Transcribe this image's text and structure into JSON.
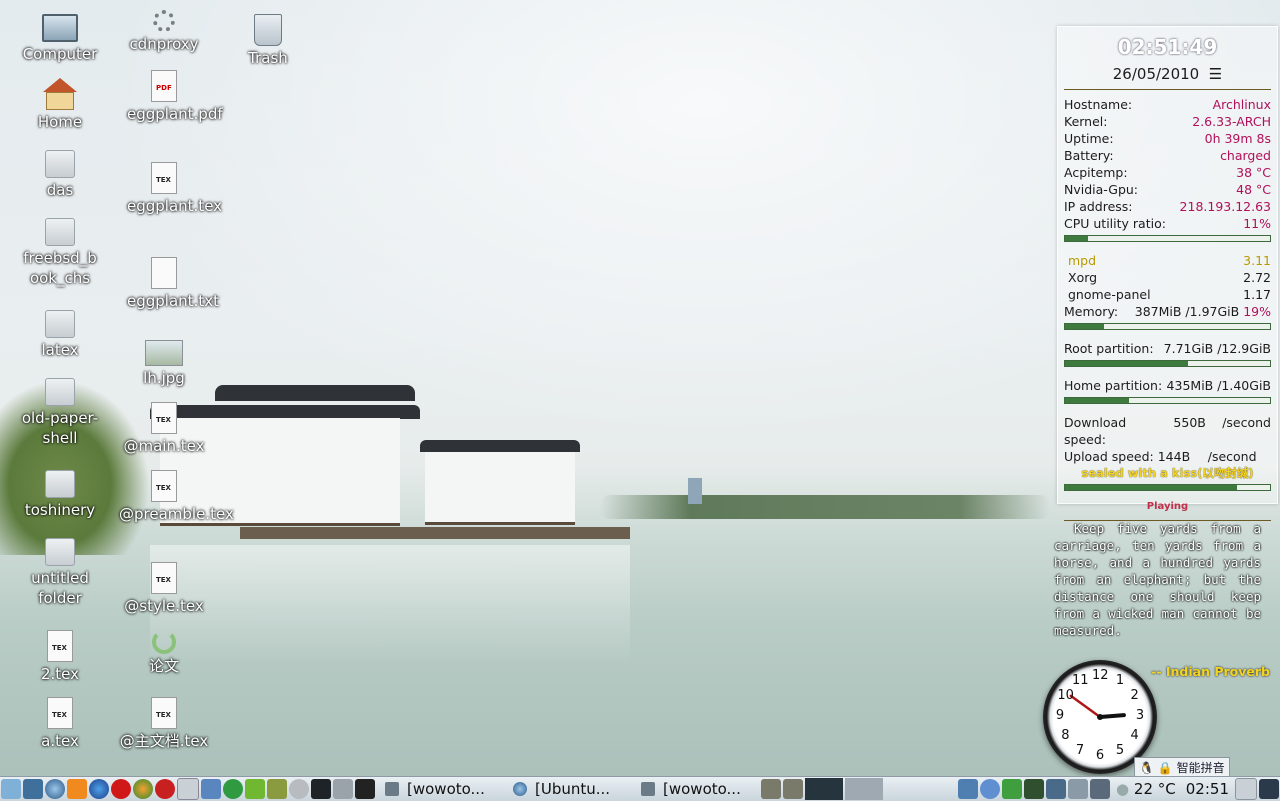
{
  "desktop": {
    "icons": [
      {
        "label": "Computer",
        "icon": "computer-icon"
      },
      {
        "label": "Home",
        "icon": "home-icon"
      },
      {
        "label": "das",
        "icon": "folder-icon"
      },
      {
        "label": "freebsd_book_chs",
        "icon": "folder-icon"
      },
      {
        "label": "latex",
        "icon": "folder-icon"
      },
      {
        "label": "old-paper-shell",
        "icon": "folder-icon"
      },
      {
        "label": "toshinery",
        "icon": "folder-icon"
      },
      {
        "label": "untitled folder",
        "icon": "folder-icon"
      },
      {
        "label": "2.tex",
        "icon": "tex-file-icon"
      },
      {
        "label": "a.tex",
        "icon": "tex-file-icon"
      },
      {
        "label": "cdnproxy",
        "icon": "gear-icon"
      },
      {
        "label": "eggplant.pdf",
        "icon": "pdf-file-icon"
      },
      {
        "label": "eggplant.tex",
        "icon": "tex-file-icon"
      },
      {
        "label": "eggplant.txt",
        "icon": "text-file-icon"
      },
      {
        "label": "lh.jpg",
        "icon": "image-file-icon"
      },
      {
        "label": "@main.tex",
        "icon": "tex-file-icon"
      },
      {
        "label": "@preamble.tex",
        "icon": "tex-file-icon"
      },
      {
        "label": "@style.tex",
        "icon": "tex-file-icon"
      },
      {
        "label": "论文",
        "icon": "refresh-icon"
      },
      {
        "label": "@主文档.tex",
        "icon": "tex-file-icon"
      },
      {
        "label": "Trash",
        "icon": "trash-icon"
      }
    ]
  },
  "conky": {
    "time": "02:51:49",
    "date": "26/05/2010",
    "menu_glyph": "☰",
    "hostname_label": "Hostname:",
    "hostname": "Archlinux",
    "kernel_label": "Kernel:",
    "kernel": "2.6.33-ARCH",
    "uptime_label": "Uptime:",
    "uptime": "0h 39m 8s",
    "battery_label": "Battery:",
    "battery": "charged",
    "acpitemp_label": "Acpitemp:",
    "acpitemp": "38 °C",
    "gpu_label": "Nvidia-Gpu:",
    "gpu": "48 °C",
    "ip_label": "IP address:",
    "ip": "218.193.12.63",
    "cpu_label": "CPU utility ratio:",
    "cpu": "11%",
    "cpu_fraction": 0.11,
    "procs": [
      {
        "name": "mpd",
        "value": "3.11"
      },
      {
        "name": "Xorg",
        "value": "2.72"
      },
      {
        "name": "gnome-panel",
        "value": "1.17"
      }
    ],
    "memory_label": "Memory:",
    "memory": "387MiB  /1.97GiB",
    "memory_pct": "19%",
    "memory_fraction": 0.19,
    "root_label": "Root partition:",
    "root": "7.71GiB /12.9GiB",
    "root_fraction": 0.6,
    "home_label": "Home  partition:",
    "home": "435MiB  /1.40GiB",
    "home_fraction": 0.31,
    "download_label": "Download speed:",
    "download": "550B",
    "upload_label": "Upload speed:",
    "upload": "144B",
    "per_second": "/second",
    "song": "sealed with a kiss(以吻封缄)",
    "song_progress": 0.84,
    "playing": "Playing"
  },
  "quote": {
    "text": "Keep five yards from a carriage, ten yards from a horse, and a hundred yards from an elephant; but the distance one should keep from a wicked man cannot be measured.",
    "source": "-- Indian Proverb"
  },
  "analog_clock": {
    "numbers": [
      "12",
      "1",
      "2",
      "3",
      "4",
      "5",
      "6",
      "7",
      "8",
      "9",
      "10",
      "11"
    ],
    "hour": 2,
    "minute": 51
  },
  "ime": {
    "label": "智能拼音"
  },
  "taskbar": {
    "tasks": [
      {
        "label": "[wowoto..."
      },
      {
        "label": "[Ubuntu..."
      },
      {
        "label": "[wowoto..."
      }
    ],
    "temperature": "22 °C",
    "clock": "02:51"
  },
  "colors": {
    "value_magenta": "#b0105a",
    "song_yellow": "#f4d420",
    "bar_green": "#3e7a3e"
  }
}
